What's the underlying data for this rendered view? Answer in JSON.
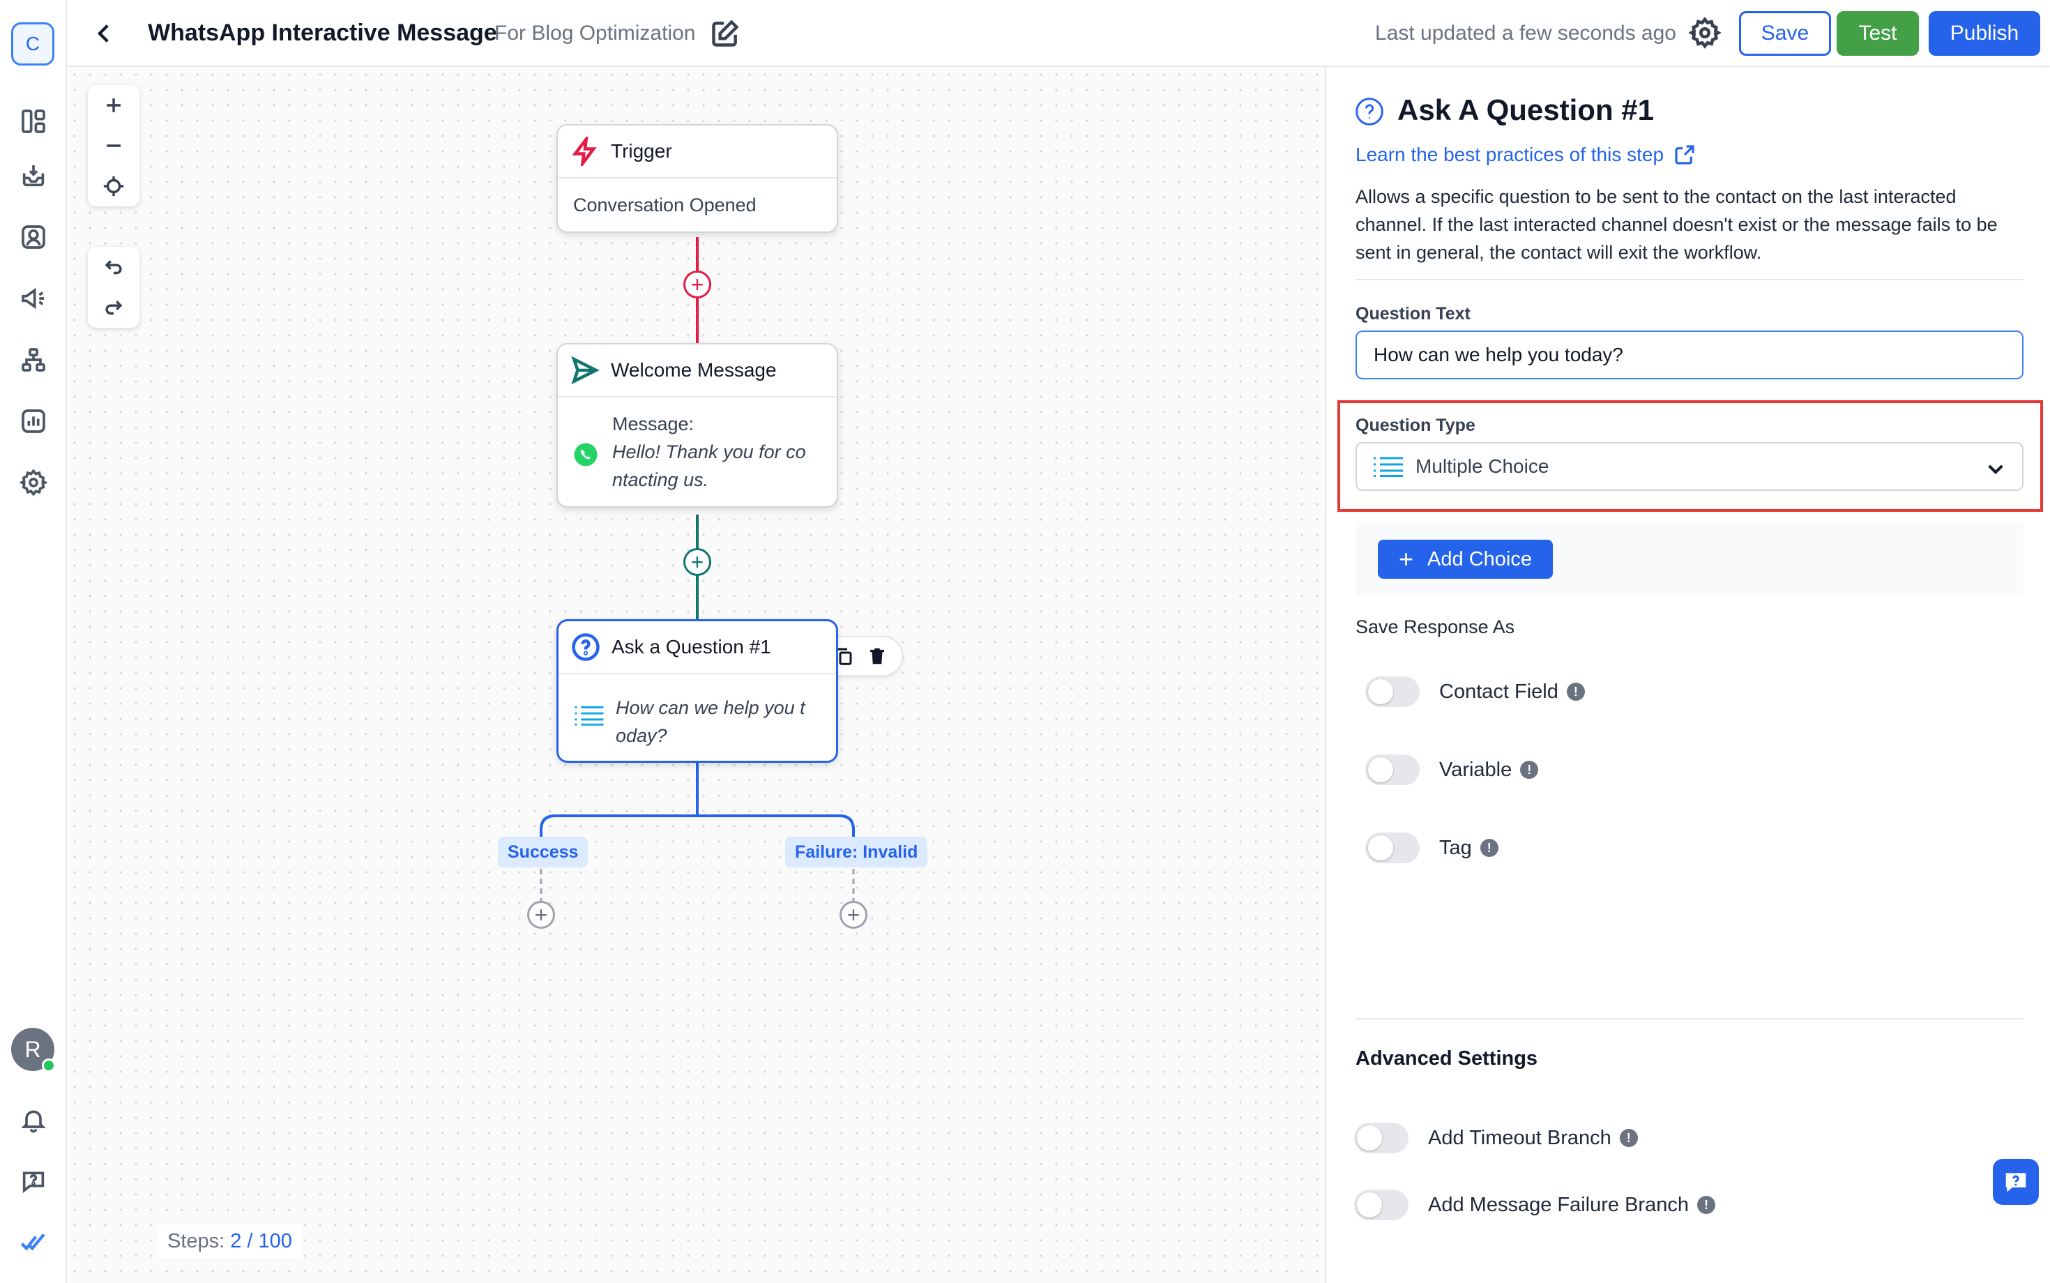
{
  "rail": {
    "logo_letter": "C",
    "items": [
      "dashboard-icon",
      "inbox-icon",
      "contacts-icon",
      "broadcast-icon",
      "workflows-icon",
      "reports-icon",
      "settings-icon"
    ],
    "avatar_letter": "R",
    "bottom_icons": [
      "bell-icon",
      "help-chat-icon",
      "checkmark-logo-icon"
    ]
  },
  "header": {
    "title": "WhatsApp Interactive Message",
    "subtitle": "For Blog Optimization",
    "last_updated": "Last updated a few seconds ago",
    "save_label": "Save",
    "test_label": "Test",
    "publish_label": "Publish"
  },
  "canvas": {
    "nodes": {
      "trigger": {
        "title": "Trigger",
        "body": "Conversation Opened"
      },
      "welcome": {
        "title": "Welcome Message",
        "body_label": "Message:",
        "body_line1": "Hello! Thank you for co",
        "body_line2": "ntacting us."
      },
      "question": {
        "title": "Ask a Question #1",
        "body_line1": "How can we help you t",
        "body_line2": "oday?"
      }
    },
    "branches": {
      "success": "Success",
      "failure": "Failure: Invalid"
    },
    "steps_label": "Steps:",
    "steps_value": "2 / 100"
  },
  "panel": {
    "title": "Ask A Question #1",
    "learn_link": "Learn the best practices of this step",
    "description": "Allows a specific question to be sent to the contact on the last interacted channel. If the last interacted channel doesn't exist or the message fails to be sent in general, the contact will exit the workflow.",
    "question_text_label": "Question Text",
    "question_text_value": "How can we help you today?",
    "question_type_label": "Question Type",
    "question_type_value": "Multiple Choice",
    "add_choice_label": "Add Choice",
    "save_response_label": "Save Response As",
    "save_options": [
      "Contact Field",
      "Variable",
      "Tag"
    ],
    "advanced_label": "Advanced Settings",
    "advanced_options": [
      "Add Timeout Branch",
      "Add Message Failure Branch"
    ]
  },
  "colors": {
    "accent": "#2563eb",
    "test_green": "#43a047",
    "trigger_pink": "#e11d48",
    "welcome_teal": "#0f766e",
    "highlight_red": "#e53935"
  }
}
